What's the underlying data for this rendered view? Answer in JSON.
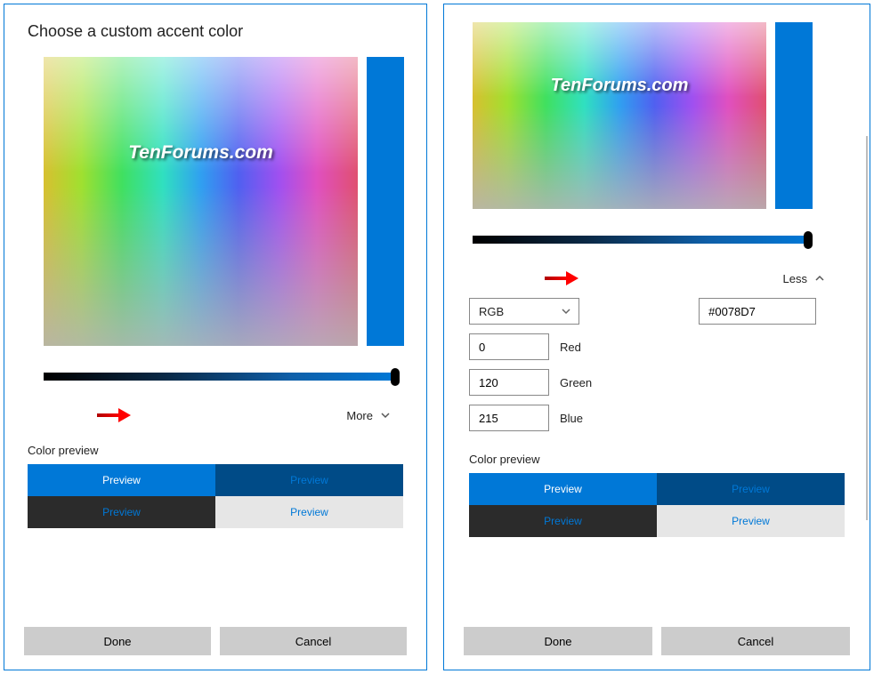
{
  "title": "Choose a custom accent color",
  "watermark": "TenForums.com",
  "accent_hex": "#0078D7",
  "toggle_more": "More",
  "toggle_less": "Less",
  "colormodel": {
    "selected": "RGB",
    "channels": [
      {
        "label": "Red",
        "value": "0"
      },
      {
        "label": "Green",
        "value": "120"
      },
      {
        "label": "Blue",
        "value": "215"
      }
    ]
  },
  "preview_section_label": "Color preview",
  "preview_cells": [
    "Preview",
    "Preview",
    "Preview",
    "Preview"
  ],
  "buttons": {
    "done": "Done",
    "cancel": "Cancel"
  }
}
